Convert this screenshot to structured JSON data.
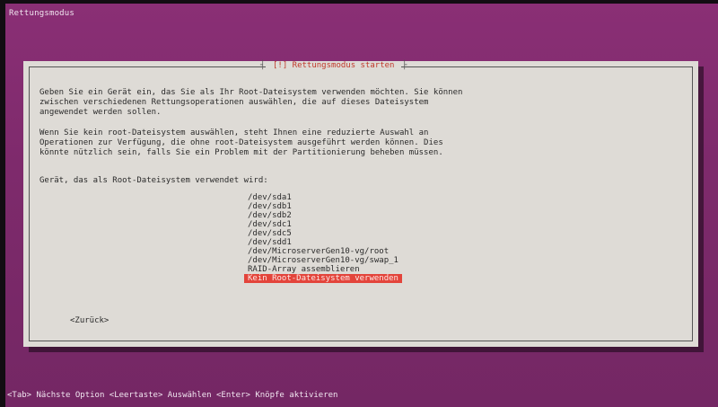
{
  "screen": {
    "title": "Rettungsmodus",
    "bottom_hint": "<Tab> Nächste Option <Leertaste> Auswählen <Enter> Knöpfe aktivieren"
  },
  "dialog": {
    "title": "[!] Rettungsmodus starten",
    "paragraph1": "Geben Sie ein Gerät ein, das Sie als Ihr Root-Dateisystem verwenden möchten. Sie können\nzwischen verschiedenen Rettungsoperationen auswählen, die auf dieses Dateisystem\nangewendet werden sollen.",
    "paragraph2": "Wenn Sie kein root-Dateisystem auswählen, steht Ihnen eine reduzierte Auswahl an\nOperationen zur Verfügung, die ohne root-Dateisystem ausgeführt werden können. Dies\nkönnte nützlich sein, falls Sie ein Problem mit der Partitionierung beheben müssen.",
    "question": "Gerät, das als Root-Dateisystem verwendet wird:",
    "options": [
      "/dev/sda1",
      "/dev/sdb1",
      "/dev/sdb2",
      "/dev/sdc1",
      "/dev/sdc5",
      "/dev/sdd1",
      "/dev/MicroserverGen10-vg/root",
      "/dev/MicroserverGen10-vg/swap_1",
      "RAID-Array assemblieren",
      "Kein Root-Dateisystem verwenden"
    ],
    "selected_option": "Kein Root-Dateisystem verwenden",
    "back_button": "<Zurück>"
  },
  "colors": {
    "background": "#8a2f75",
    "dialog": "#dedbd6",
    "title_text": "#c0392b",
    "selection": "#e3443b"
  }
}
